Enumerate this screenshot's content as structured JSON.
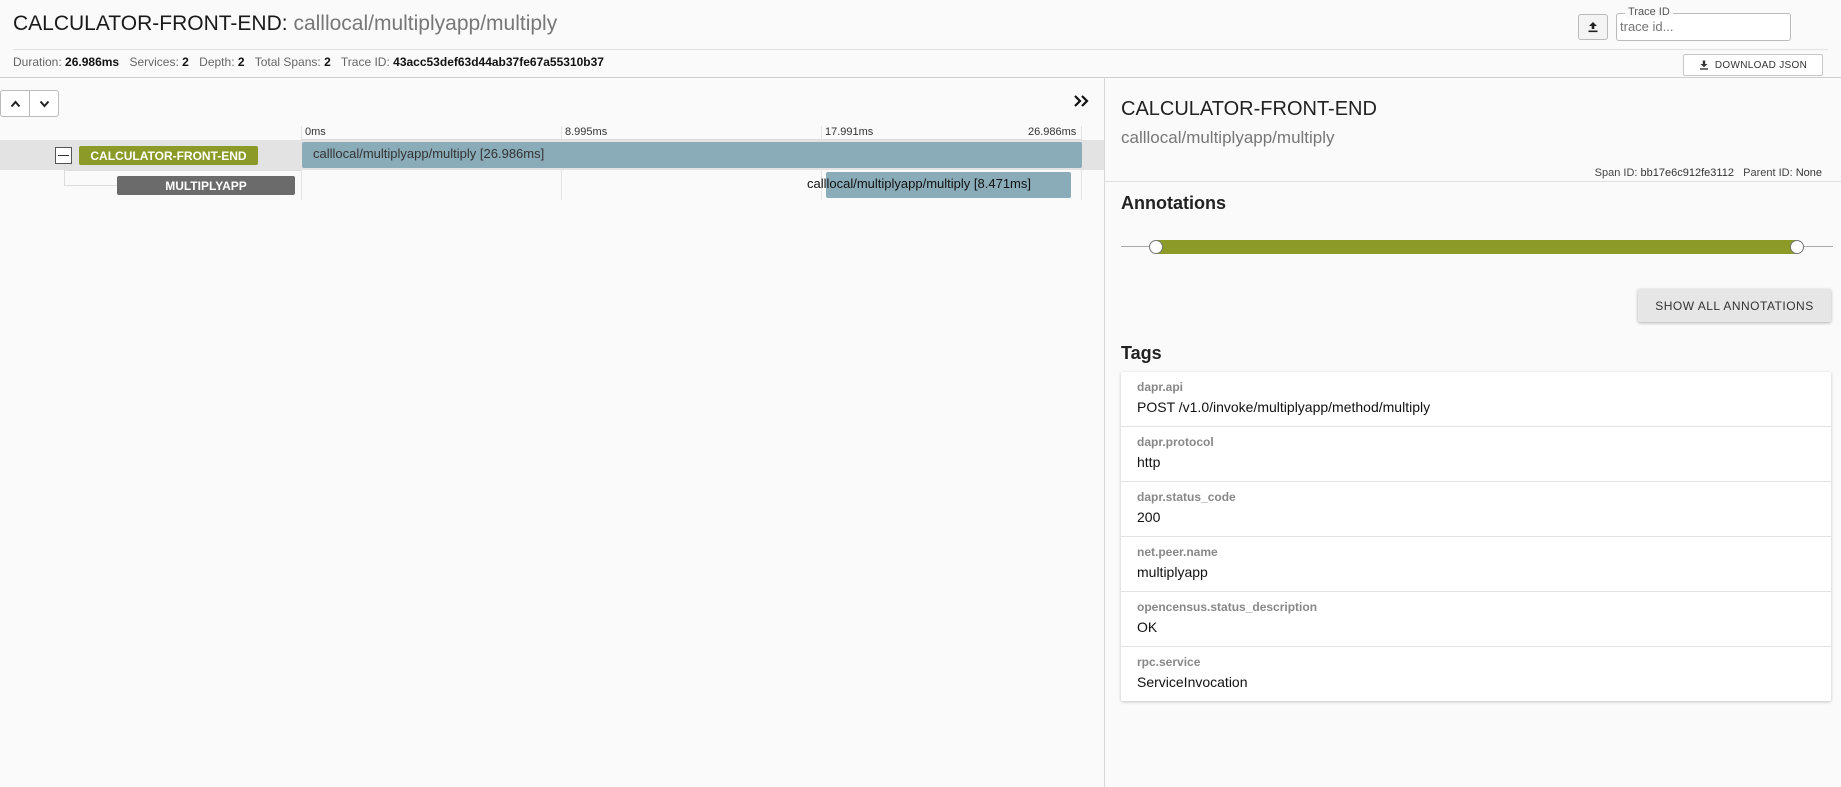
{
  "header": {
    "service": "CALCULATOR-FRONT-END",
    "separator": ":",
    "span_name": "calllocal/multiplyapp/multiply",
    "trace_id_legend": "Trace ID",
    "trace_id_placeholder": "trace id...",
    "download_label": "DOWNLOAD JSON",
    "stats": {
      "duration_label": "Duration:",
      "duration": "26.986ms",
      "services_label": "Services:",
      "services": "2",
      "depth_label": "Depth:",
      "depth": "2",
      "total_spans_label": "Total Spans:",
      "total_spans": "2",
      "trace_id_label": "Trace ID:",
      "trace_id": "43acc53def63d44ab37fe67a55310b37"
    }
  },
  "timeline": {
    "ticks": [
      "0ms",
      "8.995ms",
      "17.991ms",
      "26.986ms"
    ],
    "spans": [
      {
        "service": "CALCULATOR-FRONT-END",
        "label": "calllocal/multiplyapp/multiply [26.986ms]"
      },
      {
        "service": "MULTIPLYAPP",
        "label": "calllocal/multiplyapp/multiply [8.471ms]"
      }
    ]
  },
  "detail": {
    "service": "CALCULATOR-FRONT-END",
    "span_name": "calllocal/multiplyapp/multiply",
    "span_id_label": "Span ID:",
    "span_id": "bb17e6c912fe3112",
    "parent_id_label": "Parent ID:",
    "parent_id": "None",
    "annotations_heading": "Annotations",
    "show_all_label": "SHOW ALL ANNOTATIONS",
    "tags_heading": "Tags",
    "tags": [
      {
        "key": "dapr.api",
        "value": "POST /v1.0/invoke/multiplyapp/method/multiply"
      },
      {
        "key": "dapr.protocol",
        "value": "http"
      },
      {
        "key": "dapr.status_code",
        "value": "200"
      },
      {
        "key": "net.peer.name",
        "value": "multiplyapp"
      },
      {
        "key": "opencensus.status_description",
        "value": "OK"
      },
      {
        "key": "rpc.service",
        "value": "ServiceInvocation"
      }
    ]
  },
  "colors": {
    "front_end_service": "#8c9a27",
    "multiplyapp_service": "#6b6b6b",
    "span_bar": "#8aabb8"
  },
  "icons": [
    "upload-icon",
    "download-icon",
    "chevron-up-icon",
    "chevron-down-icon",
    "double-chevron-right-icon",
    "collapse-icon"
  ]
}
